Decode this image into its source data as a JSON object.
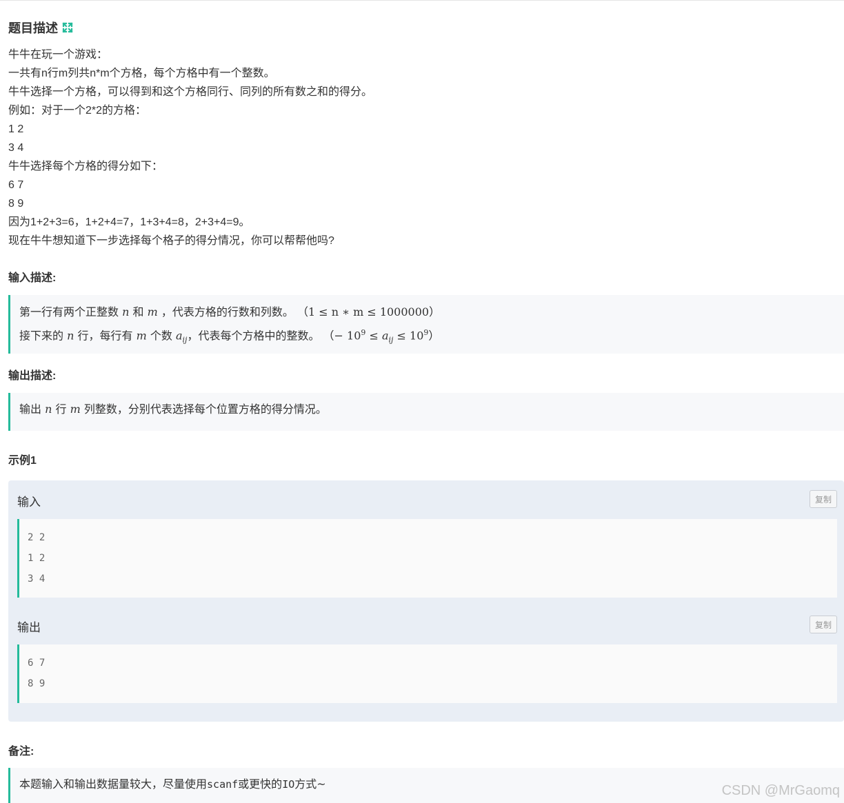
{
  "title": "题目描述",
  "description": [
    "牛牛在玩一个游戏：",
    "一共有n行m列共n*m个方格，每个方格中有一个整数。",
    "牛牛选择一个方格，可以得到和这个方格同行、同列的所有数之和的得分。",
    "例如：对于一个2*2的方格：",
    "1 2",
    "3 4",
    "牛牛选择每个方格的得分如下：",
    "6 7",
    "8 9",
    "因为1+2+3=6，1+2+4=7，1+3+4=8，2+3+4=9。",
    "现在牛牛想知道下一步选择每个格子的得分情况，你可以帮帮他吗?"
  ],
  "input_section": {
    "heading": "输入描述:",
    "line1": {
      "t1": "第一行有两个正整数 ",
      "n": "n",
      "t2": " 和 ",
      "m": "m",
      "t3": " ，代表方格的行数和列数。 （",
      "math": "1 ≤ n ∗ m ≤ 1000000",
      "t4": "）"
    },
    "line2": {
      "t1": "接下来的 ",
      "n": "n",
      "t2": " 行，每行有 ",
      "m": "m",
      "t3": " 个数 ",
      "a": "a",
      "a_sub": "ij",
      "t4": "，代表每个方格中的整数。 （",
      "m1": "− 10",
      "sup1": "9",
      "m2": " ≤ ",
      "a2": "a",
      "a2_sub": "ij",
      "m3": " ≤ 10",
      "sup2": "9",
      "t5": "）"
    }
  },
  "output_section": {
    "heading": "输出描述:",
    "line": {
      "t1": "输出 ",
      "n": "n",
      "t2": " 行 ",
      "m": "m",
      "t3": " 列整数，分别代表选择每个位置方格的得分情况。"
    }
  },
  "example": {
    "heading": "示例1",
    "input_label": "输入",
    "input_lines": [
      "2 2",
      "1 2",
      "3 4"
    ],
    "output_label": "输出",
    "output_lines": [
      "6 7",
      "8 9"
    ],
    "copy_label": "复制"
  },
  "notes": {
    "heading": "备注:",
    "t1": "本题输入和输出数据量较大，尽量使用",
    "code": "scanf",
    "t2": "或更快的",
    "code2": "IO",
    "t3": "方式~"
  },
  "watermark": "CSDN @MrGaomq",
  "colors": {
    "accent": "#25bb9b",
    "quote_bg": "#f7f8fa",
    "sample_bg": "#e9eef5"
  }
}
